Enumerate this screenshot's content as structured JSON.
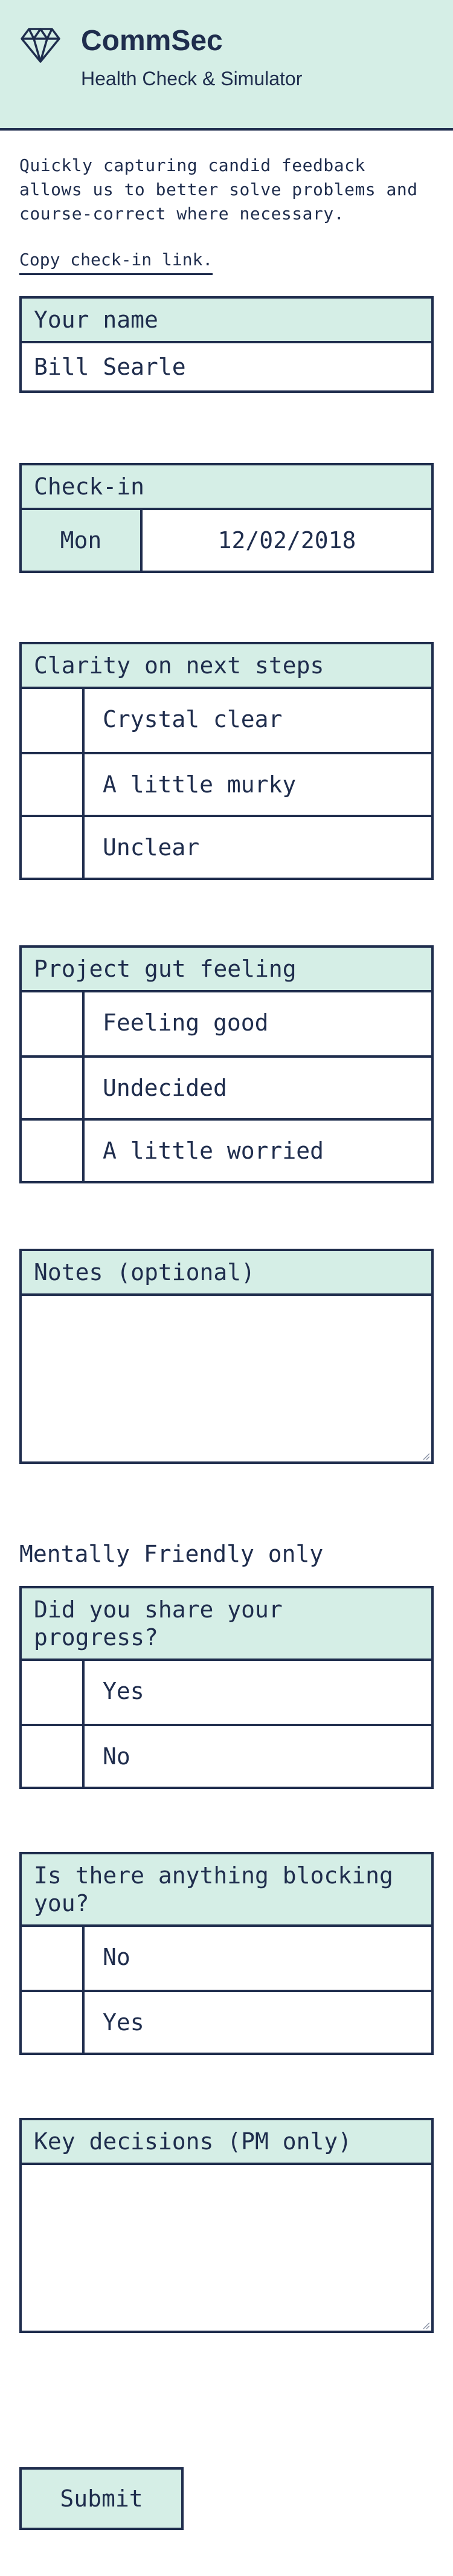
{
  "header": {
    "title": "CommSec",
    "subtitle": "Health Check & Simulator",
    "logo_icon": "diamond-icon"
  },
  "intro": {
    "text": "Quickly capturing candid feedback allows us to better solve problems and course-correct where necessary.",
    "copy_link": "Copy check-in link."
  },
  "name_field": {
    "label": "Your name",
    "value": "Bill Searle"
  },
  "checkin": {
    "label": "Check-in",
    "day": "Mon",
    "date": "12/02/2018"
  },
  "clarity": {
    "label": "Clarity on next steps",
    "options": [
      "Crystal clear",
      "A little murky",
      "Unclear"
    ]
  },
  "gut_feeling": {
    "label": "Project gut feeling",
    "options": [
      "Feeling good",
      "Undecided",
      "A little worried"
    ]
  },
  "notes": {
    "label": "Notes (optional)",
    "value": ""
  },
  "mentally_friendly": {
    "section_label": "Mentally Friendly only",
    "progress": {
      "label": "Did you share your progress?",
      "options": [
        "Yes",
        "No"
      ]
    },
    "blocking": {
      "label": "Is there anything blocking you?",
      "options": [
        "No",
        "Yes"
      ]
    }
  },
  "key_decisions": {
    "label": "Key decisions (PM only)",
    "value": ""
  },
  "submit_label": "Submit",
  "colors": {
    "accent": "#d5eee6",
    "ink": "#1f2d4d",
    "background": "#ffffff"
  }
}
